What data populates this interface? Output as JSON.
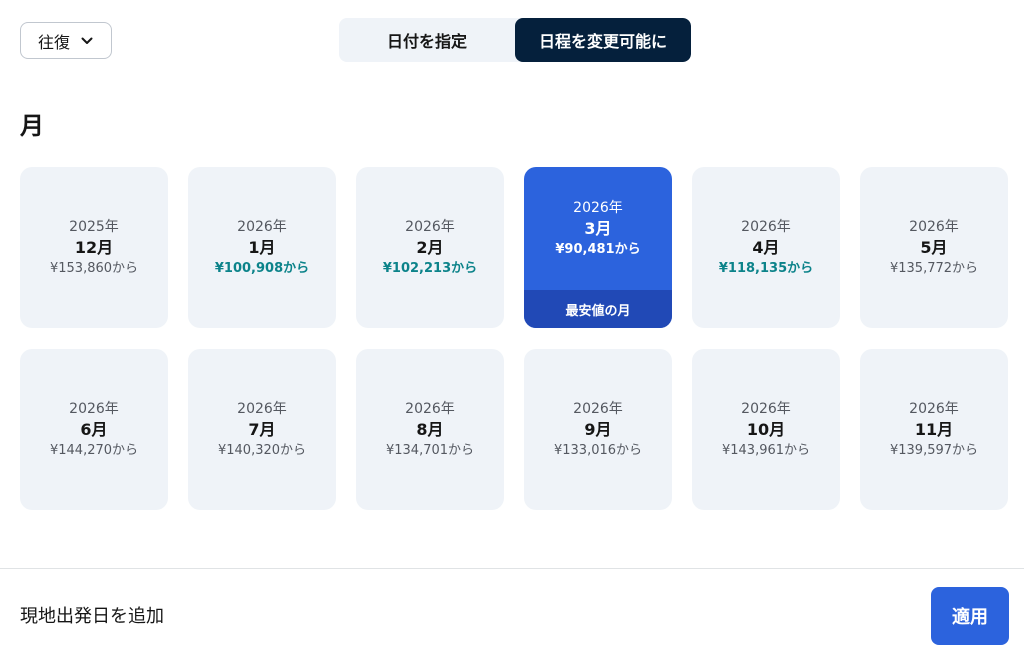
{
  "trip_type": {
    "label": "往復",
    "icon": "chevron-down-icon"
  },
  "date_mode": {
    "tabs": [
      {
        "label": "日付を指定",
        "active": false
      },
      {
        "label": "日程を変更可能に",
        "active": true
      }
    ]
  },
  "section_title": "月",
  "months": [
    {
      "year": "2025年",
      "month": "12月",
      "price": "¥153,860から",
      "highlight": false,
      "selected": false
    },
    {
      "year": "2026年",
      "month": "1月",
      "price": "¥100,908から",
      "highlight": true,
      "selected": false
    },
    {
      "year": "2026年",
      "month": "2月",
      "price": "¥102,213から",
      "highlight": true,
      "selected": false
    },
    {
      "year": "2026年",
      "month": "3月",
      "price": "¥90,481から",
      "highlight": true,
      "selected": true,
      "badge": "最安値の月"
    },
    {
      "year": "2026年",
      "month": "4月",
      "price": "¥118,135から",
      "highlight": true,
      "selected": false
    },
    {
      "year": "2026年",
      "month": "5月",
      "price": "¥135,772から",
      "highlight": false,
      "selected": false
    },
    {
      "year": "2026年",
      "month": "6月",
      "price": "¥144,270から",
      "highlight": false,
      "selected": false
    },
    {
      "year": "2026年",
      "month": "7月",
      "price": "¥140,320から",
      "highlight": false,
      "selected": false
    },
    {
      "year": "2026年",
      "month": "8月",
      "price": "¥134,701から",
      "highlight": false,
      "selected": false
    },
    {
      "year": "2026年",
      "month": "9月",
      "price": "¥133,016から",
      "highlight": false,
      "selected": false
    },
    {
      "year": "2026年",
      "month": "10月",
      "price": "¥143,961から",
      "highlight": false,
      "selected": false
    },
    {
      "year": "2026年",
      "month": "11月",
      "price": "¥139,597から",
      "highlight": false,
      "selected": false
    }
  ],
  "footer": {
    "add_local_departure": "現地出発日を追加",
    "apply_label": "適用"
  },
  "colors": {
    "accent": "#2c63dd",
    "dark_navy": "#05203c",
    "price_highlight": "#0c838a",
    "card_bg": "#eff3f8"
  }
}
